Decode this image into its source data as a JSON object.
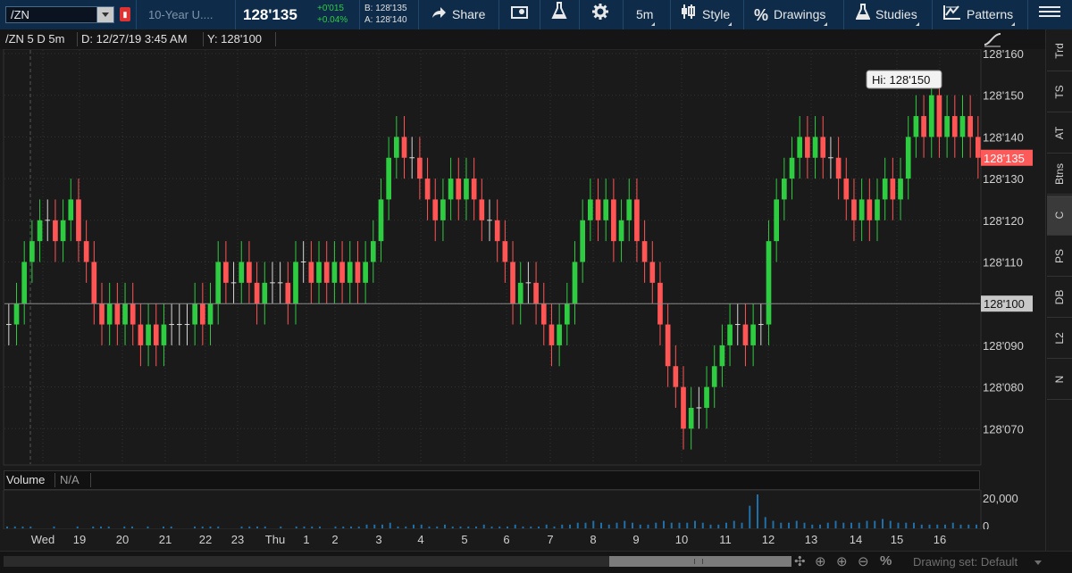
{
  "toolbar": {
    "symbol": "/ZN",
    "description": "10-Year U....",
    "last_price": "128'135",
    "change_net": "+0'015",
    "change_pct": "+0.04%",
    "bid": "B: 128'135",
    "ask": "A: 128'140",
    "share_label": "Share",
    "timeframe_label": "5m",
    "style_label": "Style",
    "drawings_label": "Drawings",
    "studies_label": "Studies",
    "patterns_label": "Patterns",
    "colors": {
      "up": "#2ecc40",
      "down": "#ff5555",
      "bar": "#0e2c4a"
    }
  },
  "header": {
    "title": "/ZN 5 D 5m",
    "date_readout": "D: 12/27/19 3:45 AM",
    "y_readout": "Y: 128'100"
  },
  "volume_panel": {
    "label": "Volume",
    "value": "N/A",
    "axis_label": "20,000",
    "axis_zero": "0"
  },
  "right_rail": {
    "tabs": [
      "Trd",
      "TS",
      "AT",
      "Btns",
      "C",
      "PS",
      "DB",
      "L2",
      "N"
    ],
    "active": "C"
  },
  "bottom_bar": {
    "drawing_set_label": "Drawing set: Default"
  },
  "chart_data": {
    "type": "ohlc",
    "symbol": "/ZN",
    "aggregation": "5m",
    "y_ticks": [
      "128'160",
      "128'150",
      "128'140",
      "128'130",
      "128'120",
      "128'110",
      "128'100",
      "128'090",
      "128'080",
      "128'070"
    ],
    "x_ticks": [
      "Wed",
      "19",
      "20",
      "21",
      "22",
      "23",
      "Thu",
      "1",
      "2",
      "3",
      "4",
      "5",
      "6",
      "7",
      "8",
      "9",
      "10",
      "11",
      "12",
      "13",
      "14",
      "15",
      "16"
    ],
    "ylim": [
      128.062,
      128.165
    ],
    "grid": true,
    "high_label": "Hi: 128'150",
    "last_price_label": "128'135",
    "cursor_price_label": "128'100",
    "cursor_price": 128.1,
    "last_price": 128.135,
    "up_color": "#2ecc40",
    "down_color": "#ff5555",
    "flat_color": "#d8d8d8",
    "series": [
      {
        "name": "/ZN",
        "values": [
          128.095,
          128.1,
          128.11,
          128.115,
          128.12,
          128.12,
          128.115,
          128.12,
          128.125,
          128.115,
          128.11,
          128.1,
          128.095,
          128.1,
          128.095,
          128.1,
          128.095,
          128.09,
          128.095,
          128.09,
          128.095,
          128.095,
          128.095,
          128.095,
          128.1,
          128.095,
          128.1,
          128.11,
          128.105,
          128.105,
          128.11,
          128.105,
          128.1,
          128.105,
          128.105,
          128.105,
          128.1,
          128.11,
          128.11,
          128.105,
          128.11,
          128.105,
          128.11,
          128.105,
          128.11,
          128.105,
          128.11,
          128.115,
          128.125,
          128.135,
          128.14,
          128.135,
          128.135,
          128.13,
          128.125,
          128.12,
          128.125,
          128.13,
          128.125,
          128.13,
          128.125,
          128.12,
          128.12,
          128.115,
          128.11,
          128.1,
          128.105,
          128.105,
          128.1,
          128.095,
          128.09,
          128.095,
          128.1,
          128.11,
          128.12,
          128.125,
          128.12,
          128.125,
          128.115,
          128.12,
          128.125,
          128.115,
          128.11,
          128.105,
          128.095,
          128.085,
          128.08,
          128.07,
          128.075,
          128.075,
          128.08,
          128.085,
          128.09,
          128.095,
          128.095,
          128.09,
          128.095,
          128.095,
          128.115,
          128.125,
          128.13,
          128.135,
          128.14,
          128.135,
          128.14,
          128.135,
          128.135,
          128.13,
          128.125,
          128.12,
          128.125,
          128.12,
          128.125,
          128.13,
          128.125,
          128.13,
          128.14,
          128.145,
          128.14,
          128.15,
          128.14,
          128.145,
          128.14,
          128.145,
          128.14,
          128.135
        ]
      }
    ],
    "volume": [
      1,
      1,
      1,
      1,
      0,
      0,
      1,
      0,
      0,
      1,
      0,
      1,
      1,
      1,
      0,
      1,
      1,
      0,
      1,
      0,
      1,
      1,
      0,
      0,
      1,
      1,
      1,
      1,
      0,
      0,
      1,
      1,
      1,
      1,
      0,
      1,
      0,
      1,
      1,
      1,
      1,
      0,
      1,
      1,
      1,
      1,
      2,
      2,
      2,
      3,
      1,
      1,
      2,
      2,
      1,
      1,
      2,
      1,
      1,
      1,
      1,
      2,
      1,
      1,
      1,
      2,
      1,
      1,
      1,
      2,
      1,
      2,
      2,
      3,
      3,
      4,
      3,
      2,
      3,
      4,
      3,
      2,
      2,
      3,
      4,
      3,
      3,
      3,
      4,
      3,
      2,
      2,
      3,
      4,
      3,
      12,
      18,
      6,
      4,
      3,
      3,
      4,
      3,
      2,
      2,
      3,
      4,
      3,
      3,
      3,
      4,
      4,
      5,
      4,
      3,
      3,
      3,
      2,
      2,
      2,
      2,
      3,
      2,
      2,
      2
    ]
  }
}
